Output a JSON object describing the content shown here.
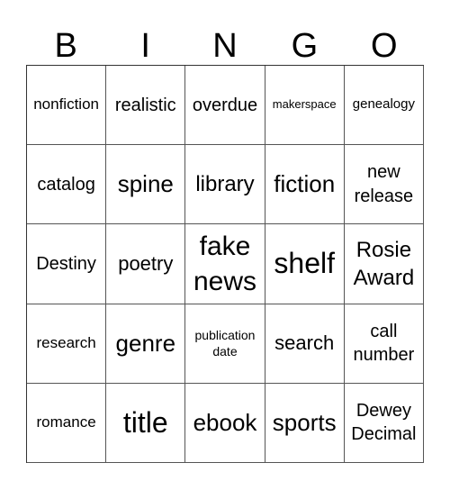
{
  "header": [
    "B",
    "I",
    "N",
    "G",
    "O"
  ],
  "cells": [
    [
      "nonfiction",
      "realistic",
      "overdue",
      "makerspace",
      "genealogy"
    ],
    [
      "catalog",
      "spine",
      "library",
      "fiction",
      "new release"
    ],
    [
      "Destiny",
      "poetry",
      "fake news",
      "shelf",
      "Rosie Award"
    ],
    [
      "research",
      "genre",
      "publication date",
      "search",
      "call number"
    ],
    [
      "romance",
      "title",
      "ebook",
      "sports",
      "Dewey Decimal"
    ]
  ]
}
